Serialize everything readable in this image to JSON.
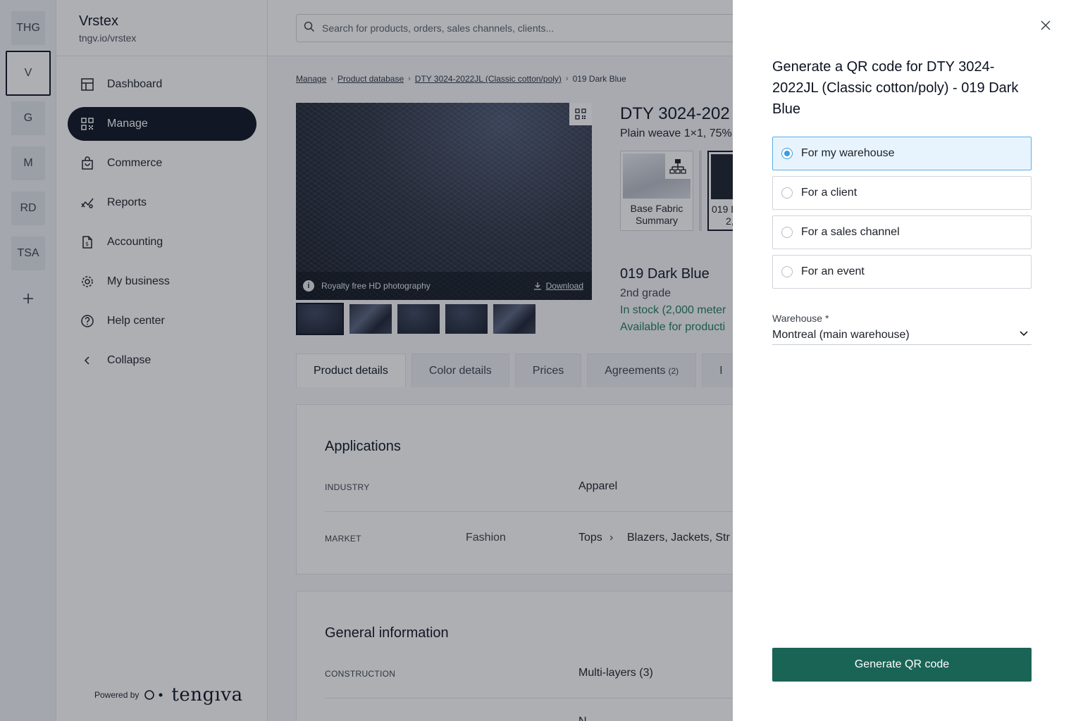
{
  "workspaces": [
    {
      "label": "THG",
      "active": false
    },
    {
      "label": "V",
      "active": true
    },
    {
      "label": "G",
      "active": false
    },
    {
      "label": "M",
      "active": false
    },
    {
      "label": "RD",
      "active": false
    },
    {
      "label": "TSA",
      "active": false
    }
  ],
  "sidebar": {
    "org_name": "Vrstex",
    "org_url": "tngv.io/vrstex",
    "items": [
      {
        "label": "Dashboard",
        "icon": "dashboard-icon"
      },
      {
        "label": "Manage",
        "icon": "grid-icon",
        "active": true
      },
      {
        "label": "Commerce",
        "icon": "shopping-bag-icon"
      },
      {
        "label": "Reports",
        "icon": "chart-line-icon"
      },
      {
        "label": "Accounting",
        "icon": "invoice-icon"
      },
      {
        "label": "My business",
        "icon": "gear-icon"
      },
      {
        "label": "Help center",
        "icon": "help-icon"
      },
      {
        "label": "Collapse",
        "icon": "chevron-left-icon"
      }
    ],
    "powered_by": "Powered by",
    "brand": "tengıva"
  },
  "search": {
    "placeholder": "Search for products, orders, sales channels, clients..."
  },
  "breadcrumb": [
    "Manage",
    "Product database",
    "DTY 3024-2022JL (Classic cotton/poly)",
    "019 Dark Blue"
  ],
  "hero": {
    "caption": "Royalty free HD photography",
    "download": "Download"
  },
  "product": {
    "title": "DTY 3024-202",
    "subtitle": "Plain weave 1×1, 75%",
    "base_card": "Base Fabric Summary",
    "variant_card_line1": "019 D",
    "variant_card_line2": "2,",
    "color_name": "019 Dark Blue",
    "grade": "2nd grade",
    "stock": "In stock (2,000 meter",
    "available": "Available for producti"
  },
  "tabs": [
    {
      "label": "Product details",
      "active": true
    },
    {
      "label": "Color details"
    },
    {
      "label": "Prices"
    },
    {
      "label": "Agreements",
      "count": "(2)"
    },
    {
      "label": "I"
    }
  ],
  "applications": {
    "heading": "Applications",
    "industry_label": "INDUSTRY",
    "industry_value": "Apparel",
    "market_label": "MARKET",
    "market_segment": "Fashion",
    "market_category": "Tops",
    "market_sub": "Blazers, Jackets, Str"
  },
  "general": {
    "heading": "General information",
    "construction_label": "CONSTRUCTION",
    "construction_value": "Multi-layers (3)",
    "next_value": "N"
  },
  "drawer": {
    "title": "Generate a QR code for DTY 3024-2022JL (Classic cotton/poly) - 019 Dark Blue",
    "options": [
      {
        "label": "For my warehouse",
        "selected": true
      },
      {
        "label": "For a client",
        "selected": false
      },
      {
        "label": "For a sales channel",
        "selected": false
      },
      {
        "label": "For an event",
        "selected": false
      }
    ],
    "warehouse_label": "Warehouse *",
    "warehouse_value": "Montreal (main warehouse)",
    "button": "Generate QR code"
  },
  "colors": {
    "primary_dark": "#0c1220",
    "button_teal": "#1a6456",
    "stock_green": "#1f7a5c",
    "selected_blue": "#3b9be0",
    "selected_bg": "#e8f4fd"
  }
}
